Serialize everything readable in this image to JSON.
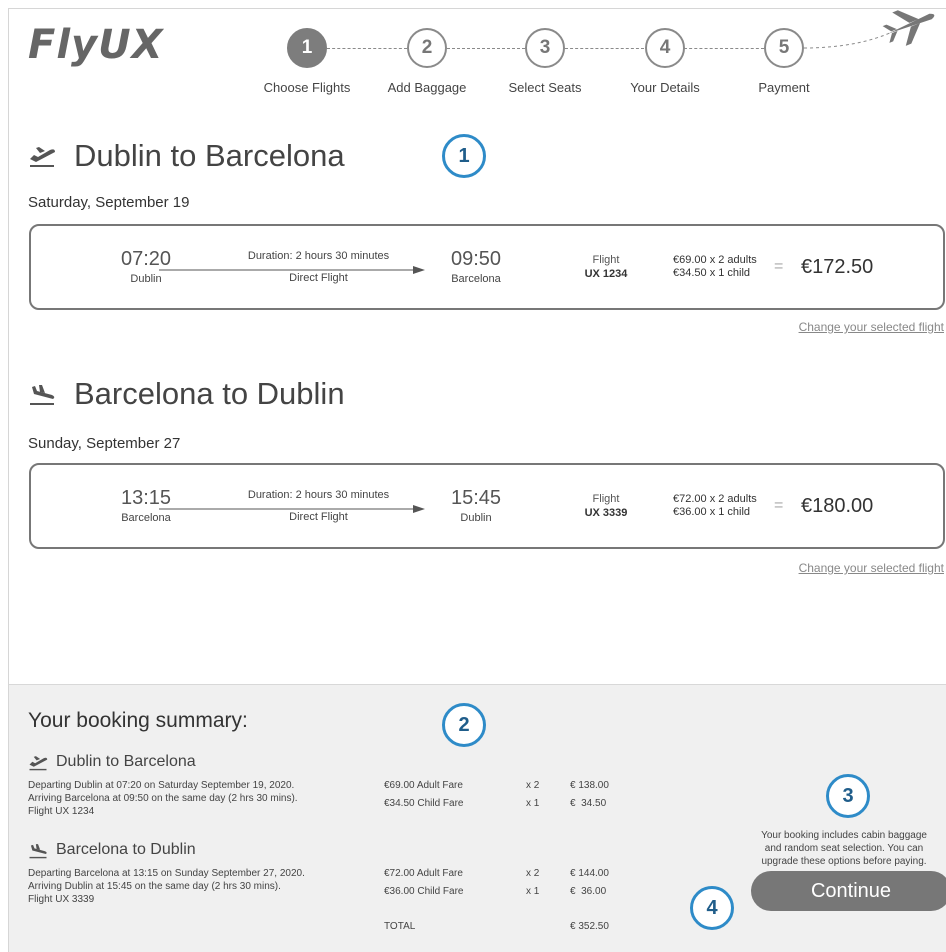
{
  "brand": {
    "logo": "FlyUX"
  },
  "steps": [
    {
      "number": "1",
      "label": "Choose Flights"
    },
    {
      "number": "2",
      "label": "Add Baggage"
    },
    {
      "number": "3",
      "label": "Select Seats"
    },
    {
      "number": "4",
      "label": "Your Details"
    },
    {
      "number": "5",
      "label": "Payment"
    }
  ],
  "outbound": {
    "title": "Dublin to Barcelona",
    "date": "Saturday, September 19",
    "depart_time": "07:20",
    "depart_city": "Dublin",
    "duration": "Duration: 2 hours 30 minutes",
    "flight_type": "Direct Flight",
    "arrive_time": "09:50",
    "arrive_city": "Barcelona",
    "flight_label": "Flight",
    "flight_number": "UX 1234",
    "fare_adults": "€69.00 x 2 adults",
    "fare_child": "€34.50 x 1 child",
    "equals": "=",
    "total": "€172.50",
    "change_link": "Change your selected flight"
  },
  "inbound": {
    "title": "Barcelona to Dublin",
    "date": "Sunday, September 27",
    "depart_time": "13:15",
    "depart_city": "Barcelona",
    "duration": "Duration: 2 hours 30 minutes",
    "flight_type": "Direct Flight",
    "arrive_time": "15:45",
    "arrive_city": "Dublin",
    "flight_label": "Flight",
    "flight_number": "UX 3339",
    "fare_adults": "€72.00 x 2 adults",
    "fare_child": "€36.00 x 1 child",
    "equals": "=",
    "total": "€180.00",
    "change_link": "Change your selected flight"
  },
  "callouts": {
    "c1": "1",
    "c2": "2",
    "c3": "3",
    "c4": "4"
  },
  "summary": {
    "title": "Your booking summary:",
    "outbound": {
      "title": "Dublin to Barcelona",
      "line1": "Departing Dublin at 07:20 on Saturday September 19, 2020.",
      "line2": "Arriving Barcelona at 09:50 on the same day (2 hrs 30 mins).",
      "line3": "Flight UX 1234",
      "fares": [
        {
          "label": "€69.00 Adult Fare",
          "qty": "x 2",
          "amount": "€ 138.00"
        },
        {
          "label": "€34.50 Child Fare",
          "qty": "x 1",
          "amount": "€  34.50"
        }
      ]
    },
    "inbound": {
      "title": "Barcelona to Dublin",
      "line1": "Departing Barcelona at 13:15 on Sunday September 27, 2020.",
      "line2": "Arriving Dublin at 15:45 on the same day  (2 hrs 30 mins).",
      "line3": "Flight UX 3339",
      "fares": [
        {
          "label": "€72.00 Adult Fare",
          "qty": "x 2",
          "amount": "€ 144.00"
        },
        {
          "label": "€36.00 Child Fare",
          "qty": "x 1",
          "amount": "€  36.00"
        }
      ]
    },
    "total_label": "TOTAL",
    "total_value": "€ 352.50",
    "note_line1": "Your booking includes cabin baggage",
    "note_line2": "and random seat selection. You can",
    "note_line3": "upgrade these options before paying.",
    "continue_label": "Continue"
  }
}
